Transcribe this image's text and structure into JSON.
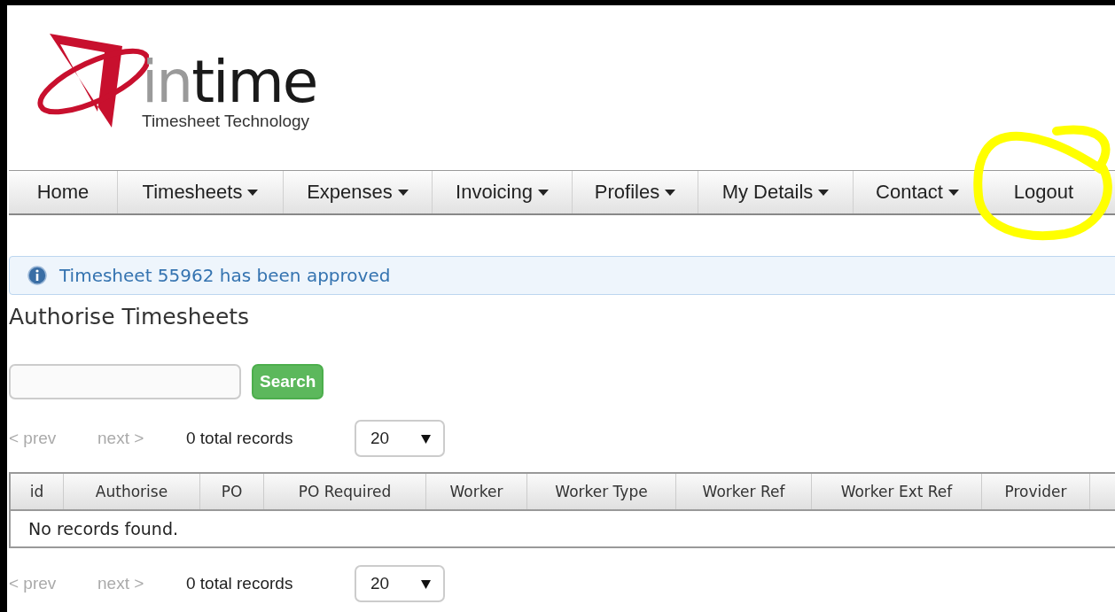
{
  "logo": {
    "word_light": "in",
    "word_dark": "time",
    "tagline": "Timesheet Technology"
  },
  "nav": [
    {
      "label": "Home",
      "dropdown": false
    },
    {
      "label": "Timesheets",
      "dropdown": true
    },
    {
      "label": "Expenses",
      "dropdown": true
    },
    {
      "label": "Invoicing",
      "dropdown": true
    },
    {
      "label": "Profiles",
      "dropdown": true
    },
    {
      "label": "My Details",
      "dropdown": true
    },
    {
      "label": "Contact",
      "dropdown": true
    },
    {
      "label": "Logout",
      "dropdown": false
    }
  ],
  "alert": {
    "text": "Timesheet 55962 has been approved"
  },
  "heading": "Authorise Timesheets",
  "search": {
    "button": "Search"
  },
  "pagers": [
    {
      "prev": {
        "label": "< prev",
        "disabled": true
      },
      "next": {
        "label": "next >",
        "disabled": true
      },
      "total": "0 total records",
      "page_size": "20"
    },
    {
      "prev": {
        "label": "< prev",
        "disabled": true
      },
      "next": {
        "label": "next >",
        "disabled": true
      },
      "total": "0 total records",
      "page_size": "20"
    }
  ],
  "table": {
    "columns": [
      "id",
      "Authorise",
      "PO",
      "PO Required",
      "Worker",
      "Worker Type",
      "Worker Ref",
      "Worker Ext Ref",
      "Provider",
      ""
    ],
    "empty_message": "No records found."
  }
}
